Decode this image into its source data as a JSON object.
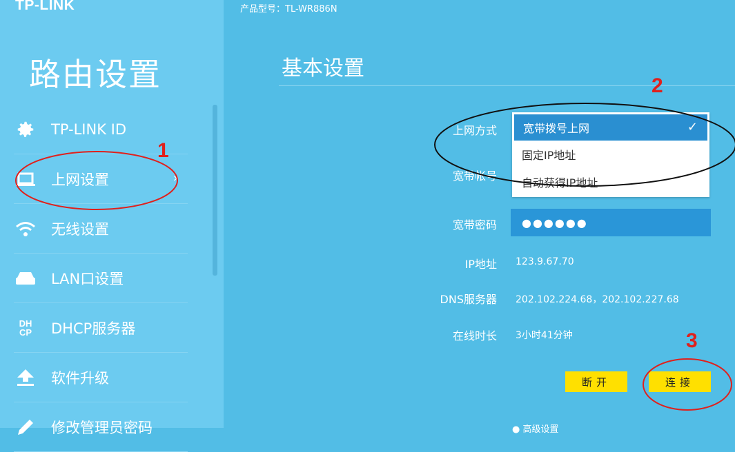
{
  "brand": {
    "logo": "TP-LINK"
  },
  "header": {
    "model": "产品型号：TL-WR886N"
  },
  "sidebar": {
    "title": "路由设置",
    "items": [
      {
        "label": "TP-LINK ID",
        "icon": "gear-icon"
      },
      {
        "label": "上网设置",
        "icon": "laptop-icon",
        "chevron": "›"
      },
      {
        "label": "无线设置",
        "icon": "wifi-icon"
      },
      {
        "label": "LAN口设置",
        "icon": "lan-icon"
      },
      {
        "label": "DHCP服务器",
        "icon": "dhcp-icon",
        "glyph": "DH\nCP"
      },
      {
        "label": "软件升级",
        "icon": "upload-icon"
      },
      {
        "label": "修改管理员密码",
        "icon": "pencil-icon"
      }
    ]
  },
  "main": {
    "title": "基本设置",
    "fields": {
      "connection_type_label": "上网方式",
      "account_label": "宽带帐号",
      "password_label": "宽带密码",
      "password_value": "●●●●●●",
      "ip_label": "IP地址",
      "ip_value": "123.9.67.70",
      "dns_label": "DNS服务器",
      "dns_value": "202.102.224.68，202.102.227.68",
      "uptime_label": "在线时长",
      "uptime_value": "3小时41分钟"
    },
    "dropdown": {
      "selected": "宽带拨号上网",
      "options": [
        "宽带拨号上网",
        "固定IP地址",
        "自动获得IP地址"
      ]
    },
    "buttons": {
      "disconnect": "断开",
      "connect": "连接"
    },
    "bottom_hint": "● 高级设置"
  },
  "annotations": {
    "one": "1",
    "two": "2",
    "three": "3"
  },
  "colors": {
    "sidebar_bg": "#6ccbf0",
    "main_bg": "#52bde6",
    "selected_option": "#2a8fd1",
    "button": "#ffe000",
    "annotation": "#e0201c"
  }
}
